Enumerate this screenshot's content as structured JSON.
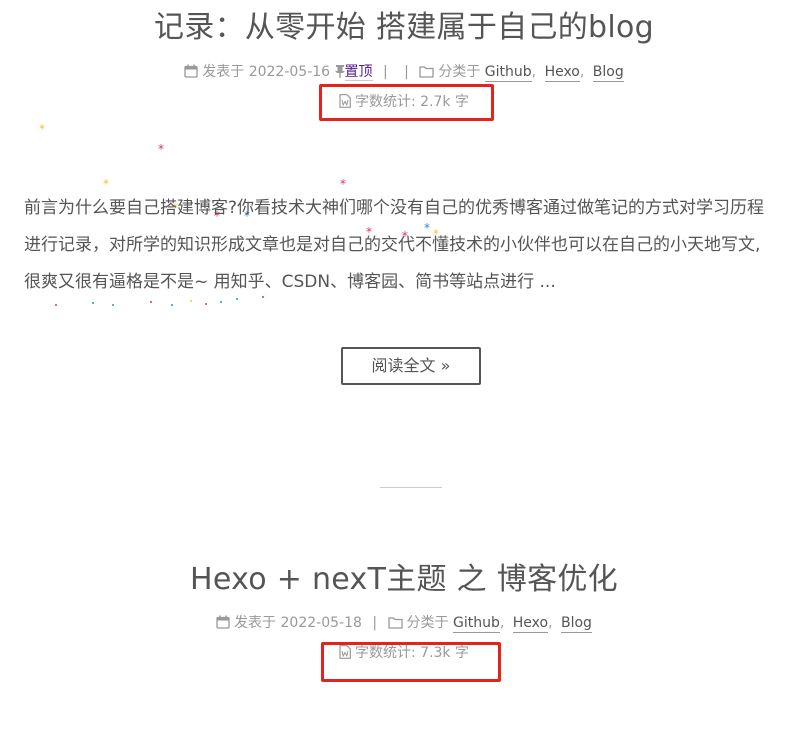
{
  "posts": [
    {
      "title": "记录：从零开始 搭建属于自己的blog",
      "posted_label": "发表于",
      "date": "2022-05-16",
      "pin_label": "置顶",
      "separator": "|",
      "category_label": "分类于",
      "categories": [
        "Github",
        "Hexo",
        "Blog"
      ],
      "wordcount_label": "字数统计:",
      "wordcount_value": "2.7k",
      "wordcount_unit": "字",
      "excerpt_lines": [
        "前言为什么要自己搭建博客?你看技术大神们哪个没有自己的优秀博客通过做笔记的方式对学习历程",
        "进行记录，对所学的知识形成文章也是对自己的交代不懂技术的小伙伴也可以在自己的小天地写文,",
        "很爽又很有逼格是不是~ 用知乎、CSDN、博客园、简书等站点进行 ..."
      ],
      "read_more": "阅读全文 »"
    },
    {
      "title": "Hexo + nexT主题 之 博客优化",
      "posted_label": "发表于",
      "date": "2022-05-18",
      "separator": "|",
      "category_label": "分类于",
      "categories": [
        "Github",
        "Hexo",
        "Blog"
      ],
      "wordcount_label": "字数统计:",
      "wordcount_value": "7.3k",
      "wordcount_unit": "字"
    }
  ],
  "comma": ",",
  "icons": {
    "calendar": "calendar-icon",
    "pin": "pushpin-icon",
    "folder": "folder-icon",
    "file": "file-word-icon"
  },
  "colors": {
    "text": "#555555",
    "meta": "#999999",
    "highlight": "#e4231d",
    "visited_link": "#551a8b"
  }
}
